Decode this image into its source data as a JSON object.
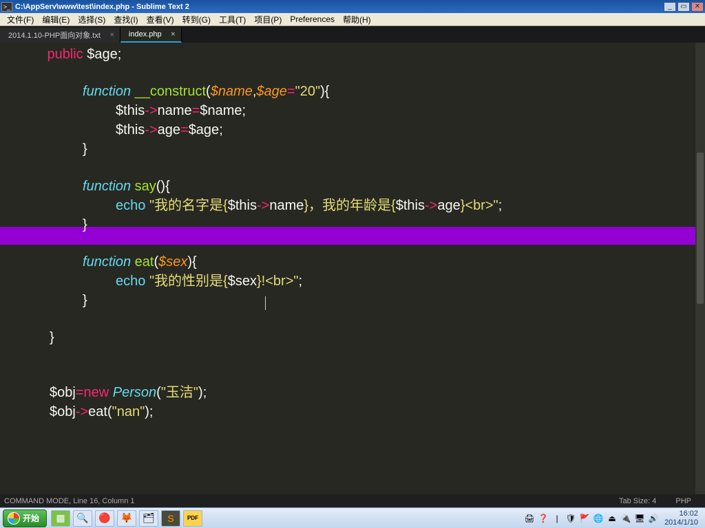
{
  "window": {
    "title": "C:\\AppServ\\www\\test\\index.php - Sublime Text 2"
  },
  "menu": {
    "file": "文件(F)",
    "edit": "编辑(E)",
    "select": "选择(S)",
    "find": "查找(I)",
    "view": "查看(V)",
    "goto": "转到(G)",
    "tools": "工具(T)",
    "project": "项目(P)",
    "prefs": "Preferences",
    "help": "帮助(H)"
  },
  "tabs": {
    "inactive": "2014.1.10-PHP面向对象.txt",
    "active": "index.php"
  },
  "code": {
    "l1_public": "public",
    "l1_var": " $age",
    "l1_semi": ";",
    "l3_fn": "function",
    "l3_name": " __construct",
    "l3_p1": "$name",
    "l3_p2": "$age",
    "l3_def": "\"20\"",
    "l4_this": "$this",
    "l4_arrow": "->",
    "l4_prop1": "name",
    "l4_eq": "=",
    "l4_varname": "$name",
    "l5_prop2": "age",
    "l5_varage": "$age",
    "l8_fn": "function",
    "l8_name": " say",
    "l9_echo": "echo",
    "l9_str1": " \"我的名字是{",
    "l9_this": "$this",
    "l9_prop1": "name",
    "l9_str2": "}，我的年龄是{",
    "l9_prop2": "age",
    "l9_str3": "}<br>\"",
    "l12_fn": "function",
    "l12_name": " eat",
    "l12_param": "$sex",
    "l13_echo": "echo",
    "l13_str1": " \"我的性别是{",
    "l13_param": "$sex",
    "l13_str2": "}!<br>\"",
    "l18_obj": "$obj",
    "l18_new": "new",
    "l18_cls": " Person",
    "l18_arg": "\"玉洁\"",
    "l19_method": "eat",
    "l19_arg": "\"nan\""
  },
  "status": {
    "left": "COMMAND MODE, Line 16, Column 1",
    "tabsize": "Tab Size: 4",
    "syntax": "PHP"
  },
  "taskbar": {
    "start": "开始",
    "clock_time": "16:02",
    "clock_date": "2014/1/10"
  }
}
